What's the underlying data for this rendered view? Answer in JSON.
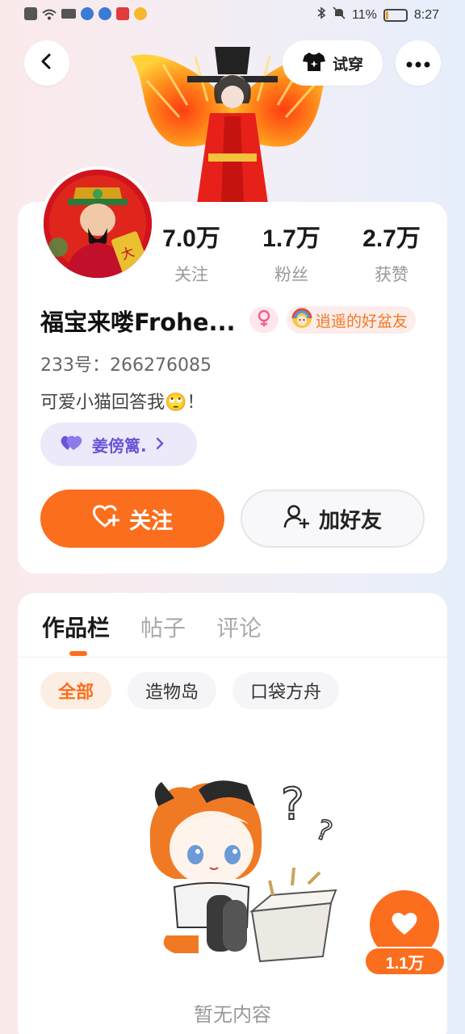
{
  "status_bar": {
    "battery_text": "11%",
    "time": "8:27",
    "battery_level": 0.11
  },
  "header": {
    "tryon_label": "试穿"
  },
  "profile": {
    "stats": [
      {
        "value": "7.0万",
        "label": "关注"
      },
      {
        "value": "1.7万",
        "label": "粉丝"
      },
      {
        "value": "2.7万",
        "label": "获赞"
      }
    ],
    "nickname": "福宝来喽Frohe...",
    "title_badge": "逍遥的好盆友",
    "uid": "233号：266276085",
    "bio": "可爱小猫回答我🙄！",
    "cp_name": "姜傍篱.",
    "follow_label": "关注",
    "add_friend_label": "加好友"
  },
  "works": {
    "tabs": [
      "作品栏",
      "帖子",
      "评论"
    ],
    "active_tab": 0,
    "chips": [
      "全部",
      "造物岛",
      "口袋方舟"
    ],
    "active_chip": 0,
    "empty_text": "暂无内容"
  },
  "floating_like": {
    "count": "1.1万"
  },
  "colors": {
    "accent": "#fb6e1d",
    "cp_purple": "#6a55d8",
    "title_orange": "#f07a24"
  },
  "icons": {
    "back": "chevron-left-icon",
    "tryon": "tshirt-icon",
    "more": "more-dots-icon",
    "gender": "female-icon",
    "cp": "hearts-icon",
    "follow": "heart-plus-icon",
    "add_friend": "person-plus-icon",
    "like": "heart-icon"
  }
}
